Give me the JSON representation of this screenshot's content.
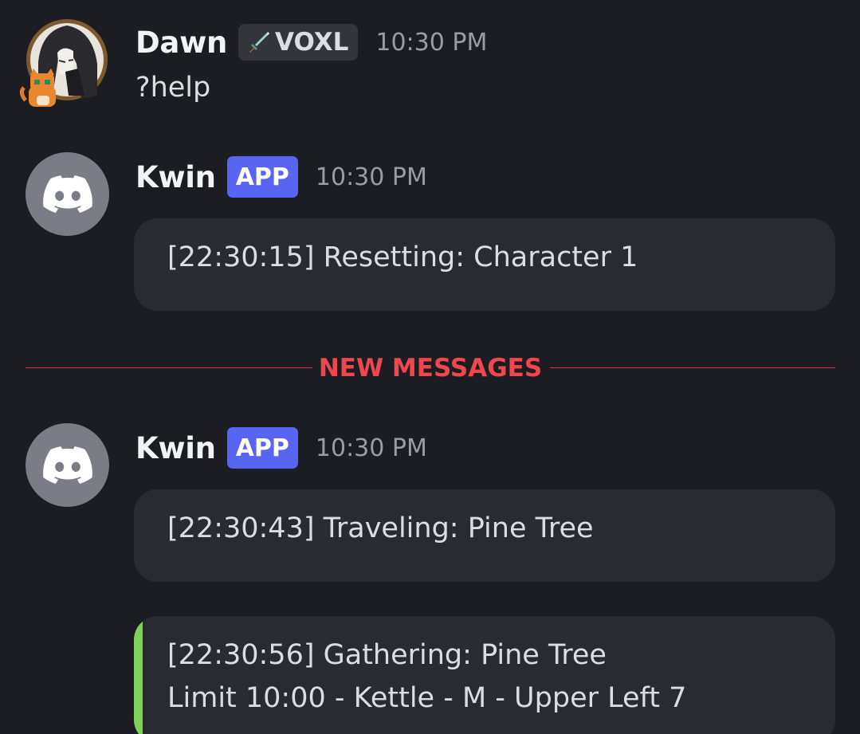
{
  "messages": [
    {
      "author": "Dawn",
      "tag": "VOXL",
      "time": "10:30 PM",
      "text": "?help"
    },
    {
      "author": "Kwin",
      "badge": "APP",
      "time": "10:30 PM",
      "embed": [
        "[22:30:15] Resetting: Character 1"
      ]
    },
    {
      "author": "Kwin",
      "badge": "APP",
      "time": "10:30 PM",
      "embed": [
        "[22:30:43] Traveling: Pine Tree"
      ],
      "embed2": [
        "[22:30:56] Gathering: Pine Tree",
        "Limit 10:00 - Kettle - M - Upper Left 7"
      ]
    }
  ],
  "divider": {
    "label": "NEW MESSAGES"
  },
  "colors": {
    "background": "#1c1d22",
    "app_badge": "#5865f2",
    "new_messages": "#f0474e",
    "embed_accent": "#81d05a"
  },
  "icons": {
    "bot_avatar": "discord-logo-icon",
    "tag_icon": "sword-icon"
  }
}
